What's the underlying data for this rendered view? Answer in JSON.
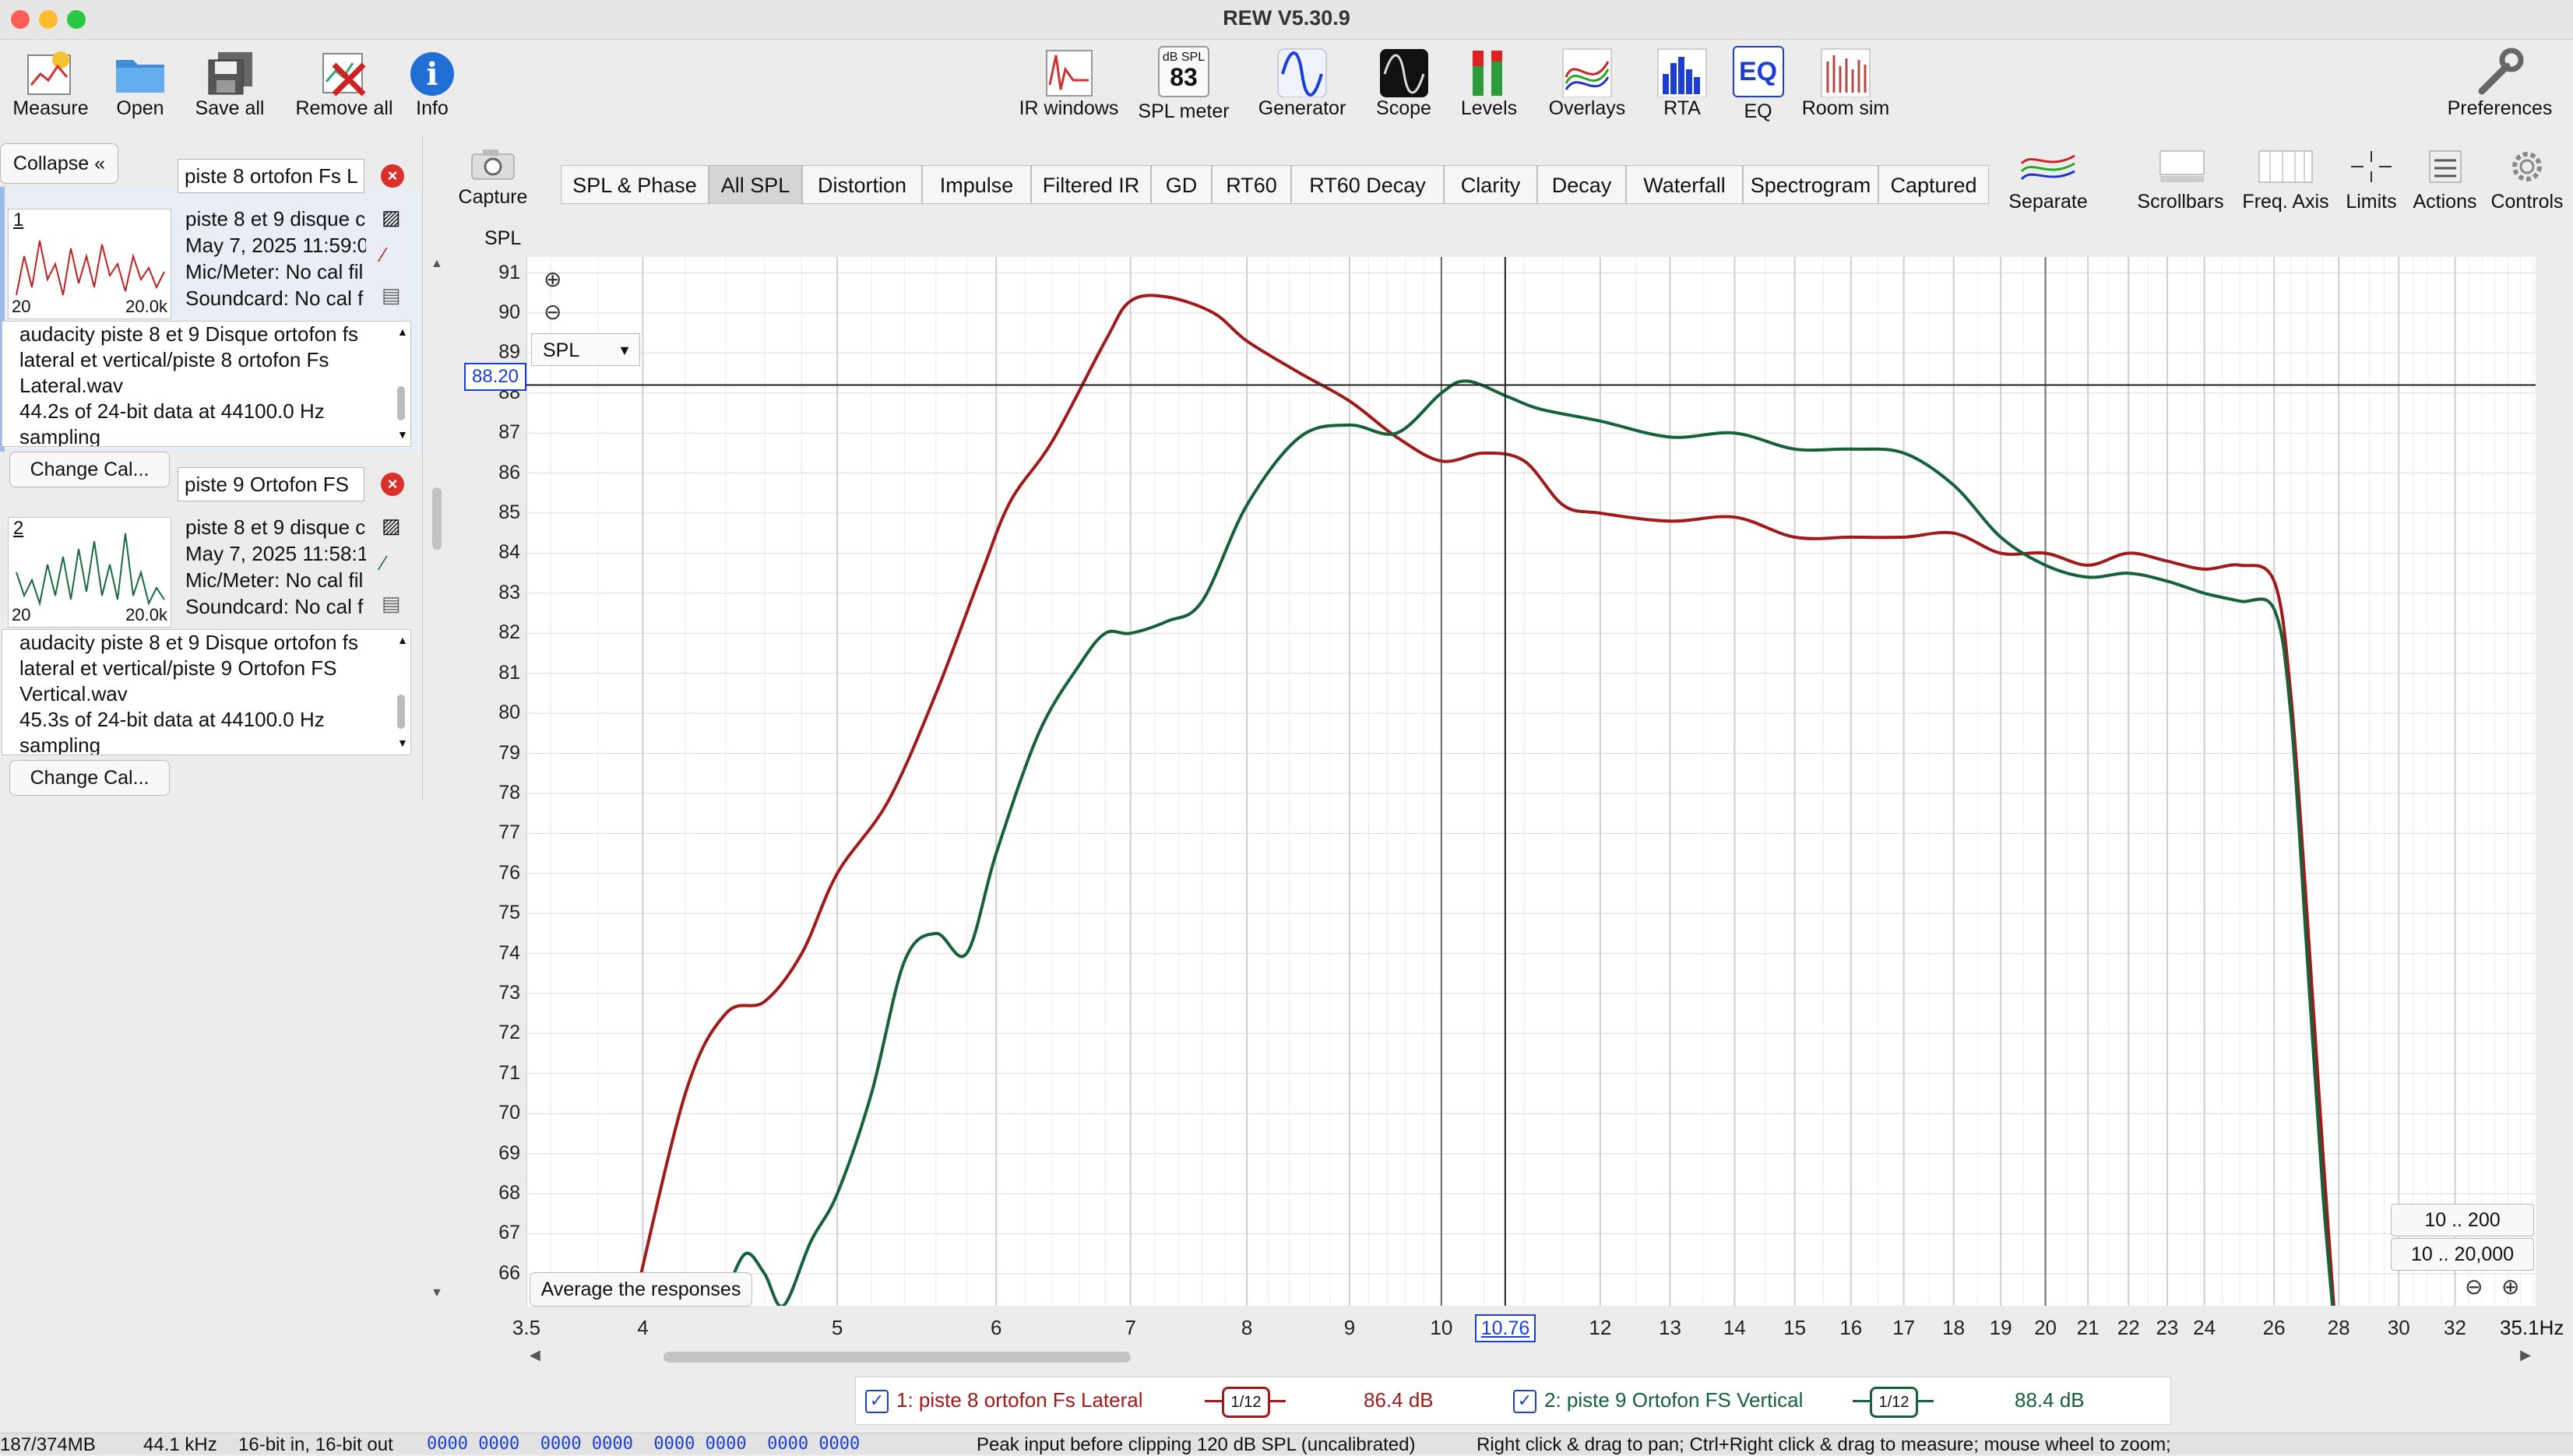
{
  "window": {
    "title": "REW V5.30.9"
  },
  "toolbar": {
    "measure": "Measure",
    "open": "Open",
    "save_all": "Save all",
    "remove_all": "Remove all",
    "info": "Info",
    "ir_windows": "IR windows",
    "spl_meter": "SPL meter",
    "spl_meter_icon_top": "dB SPL",
    "spl_meter_icon_value": "83",
    "generator": "Generator",
    "scope": "Scope",
    "levels": "Levels",
    "overlays": "Overlays",
    "rta": "RTA",
    "eq": "EQ",
    "eq_icon_text": "EQ",
    "room_sim": "Room sim",
    "preferences": "Preferences"
  },
  "left_panel": {
    "collapse_label": "Collapse",
    "m1": {
      "name": "piste 8 ortofon Fs L",
      "index": "1",
      "thumb_x_min": "20",
      "thumb_x_max": "20.0k",
      "meta1": "piste 8 et 9 disque c",
      "meta2": "May 7, 2025 11:59:0",
      "meta3": "Mic/Meter: No cal fil",
      "meta4": "Soundcard: No cal f",
      "notes": [
        "audacity piste 8 et 9 Disque ortofon fs",
        "lateral et vertical/piste 8 ortofon Fs",
        "Lateral.wav",
        "44.2s of 24-bit data at 44100.0 Hz",
        "sampling"
      ],
      "change_cal": "Change Cal..."
    },
    "m2": {
      "name": "piste 9 Ortofon FS",
      "index": "2",
      "thumb_x_min": "20",
      "thumb_x_max": "20.0k",
      "meta1": "piste 8 et 9 disque c",
      "meta2": "May 7, 2025 11:58:1",
      "meta3": "Mic/Meter: No cal fil",
      "meta4": "Soundcard: No cal f",
      "notes": [
        "audacity piste 8 et 9 Disque ortofon fs",
        "lateral et vertical/piste 9 Ortofon FS",
        "Vertical.wav",
        "45.3s of 24-bit data at 44100.0 Hz",
        "sampling"
      ],
      "change_cal": "Change Cal..."
    }
  },
  "graph_toolbar": {
    "capture": "Capture",
    "tabs": [
      "SPL & Phase",
      "All SPL",
      "Distortion",
      "Impulse",
      "Filtered IR",
      "GD",
      "RT60",
      "RT60 Decay",
      "Clarity",
      "Decay",
      "Waterfall",
      "Spectrogram",
      "Captured"
    ],
    "selected_tab": "All SPL",
    "right": {
      "separate": "Separate",
      "scrollbars": "Scrollbars",
      "freq_axis": "Freq. Axis",
      "limits": "Limits",
      "actions": "Actions",
      "controls": "Controls"
    }
  },
  "plot": {
    "y_unit": "SPL",
    "y_selector": "SPL",
    "cursor_y": "88.20",
    "cursor_x": "10.76",
    "x_unit_label": "35.1Hz",
    "average_button": "Average the responses",
    "range_btn_1": "10 .. 200",
    "range_btn_2": "10 .. 20,000"
  },
  "chart_data": {
    "type": "line",
    "xlabel": "Hz",
    "ylabel": "SPL",
    "xlim": [
      3.5,
      35.1
    ],
    "ylim": [
      65.2,
      91.4
    ],
    "x_scale": "log",
    "y_ticks": [
      66,
      67,
      68,
      69,
      70,
      71,
      72,
      73,
      74,
      75,
      76,
      77,
      78,
      79,
      80,
      81,
      82,
      83,
      84,
      85,
      86,
      87,
      88,
      89,
      90,
      91
    ],
    "x_ticks": [
      "3.5",
      "4",
      "5",
      "6",
      "7",
      "8",
      "9",
      "10",
      "12",
      "13",
      "14",
      "15",
      "16",
      "17",
      "18",
      "19",
      "20",
      "21",
      "22",
      "23",
      "24",
      "26",
      "28",
      "30",
      "32"
    ],
    "grid": true,
    "cursor": {
      "x": 10.76,
      "y": 88.2
    },
    "series": [
      {
        "name": "1: piste 8 ortofon Fs Lateral",
        "color": "#a01a1a",
        "x": [
          3.95,
          4.2,
          4.4,
          4.6,
          4.8,
          5.0,
          5.3,
          5.6,
          5.9,
          6.1,
          6.4,
          6.8,
          7.0,
          7.3,
          7.7,
          8.0,
          8.5,
          9.0,
          9.5,
          10.0,
          10.5,
          11.0,
          11.5,
          12.0,
          13.0,
          14.0,
          15.0,
          16.0,
          17.0,
          18.0,
          19.0,
          20.0,
          21.0,
          22.0,
          23.0,
          24.0,
          25.0,
          26.0,
          26.5,
          27.0,
          27.5,
          28.0
        ],
        "y": [
          65.0,
          70.5,
          72.5,
          72.8,
          74.0,
          76.0,
          77.8,
          80.5,
          83.5,
          85.3,
          86.8,
          89.3,
          90.3,
          90.4,
          90.0,
          89.3,
          88.5,
          87.8,
          86.9,
          86.3,
          86.5,
          86.3,
          85.2,
          85.0,
          84.8,
          84.9,
          84.4,
          84.4,
          84.4,
          84.5,
          84.0,
          84.0,
          83.7,
          84.0,
          83.8,
          83.6,
          83.7,
          83.3,
          80.5,
          75.0,
          69.0,
          63.5
        ]
      },
      {
        "name": "2: piste 9 Ortofon FS Vertical",
        "color": "#14613a",
        "x": [
          4.4,
          4.5,
          4.6,
          4.7,
          4.85,
          5.0,
          5.2,
          5.4,
          5.6,
          5.8,
          6.0,
          6.3,
          6.6,
          6.8,
          7.0,
          7.3,
          7.6,
          8.0,
          8.5,
          9.0,
          9.5,
          10.0,
          10.3,
          10.8,
          11.2,
          12.0,
          13.0,
          14.0,
          15.0,
          16.0,
          17.0,
          18.0,
          19.0,
          20.0,
          21.0,
          22.0,
          23.0,
          24.0,
          25.0,
          26.0,
          26.5,
          27.0,
          27.5,
          28.0
        ],
        "y": [
          65.5,
          66.5,
          66.0,
          65.2,
          66.8,
          68.0,
          70.5,
          73.8,
          74.5,
          74.0,
          76.5,
          79.5,
          81.2,
          82.0,
          82.0,
          82.3,
          82.8,
          85.2,
          86.9,
          87.2,
          87.0,
          88.0,
          88.3,
          87.9,
          87.6,
          87.3,
          86.9,
          87.0,
          86.6,
          86.6,
          86.5,
          85.7,
          84.4,
          83.7,
          83.4,
          83.5,
          83.3,
          83.0,
          82.8,
          82.6,
          80.0,
          74.0,
          68.0,
          63.5
        ]
      }
    ]
  },
  "legend": {
    "s1_label": "1: piste 8 ortofon Fs Lateral",
    "s1_smoothing": "1/12",
    "s1_value": "86.4 dB",
    "s2_label": "2: piste 9 Ortofon FS Vertical",
    "s2_smoothing": "1/12",
    "s2_value": "88.4 dB"
  },
  "status": {
    "memory": "187/374MB",
    "rate": "44.1 kHz",
    "bits": "16-bit in, 16-bit out",
    "bits_readout": "0000 0000  0000 0000  0000 0000  0000 0000",
    "peak": "Peak input before clipping 120 dB SPL (uncalibrated)",
    "hint": "Right click & drag to pan; Ctrl+Right click & drag to measure; mouse wheel to zoom;"
  },
  "colors": {
    "red_series": "#a01a1a",
    "green_series": "#14613a",
    "cursor_blue": "#1b3fd6",
    "close_red": "#d9302b"
  }
}
